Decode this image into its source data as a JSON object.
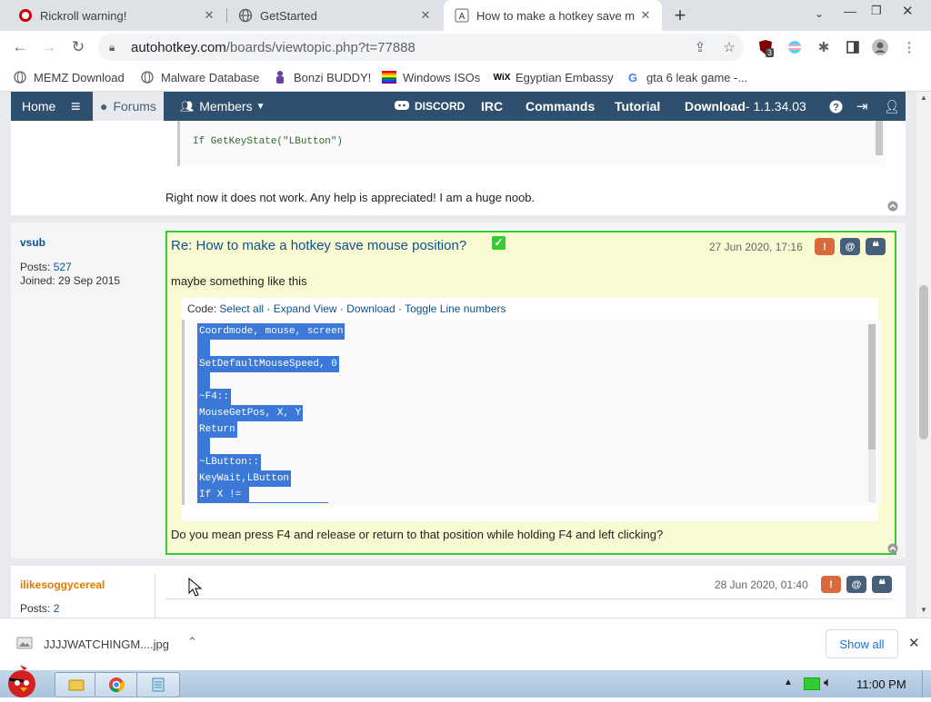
{
  "tabs": [
    {
      "title": "Rickroll warning!",
      "icon": "youtube-icon",
      "active": false
    },
    {
      "title": "GetStarted",
      "icon": "globe-icon",
      "active": false
    },
    {
      "title": "How to make a hotkey save m",
      "icon": "autohotkey-icon",
      "active": true
    }
  ],
  "new_tab_label": "+",
  "address": {
    "domain": "autohotkey.com",
    "path": "/boards/viewtopic.php?t=77888"
  },
  "extension_badge": "3",
  "bookmarks": [
    {
      "label": "MEMZ Download",
      "icon": "globe-icon"
    },
    {
      "label": "Malware Database",
      "icon": "globe-icon"
    },
    {
      "label": "Bonzi BUDDY!",
      "icon": "bonzi-icon"
    },
    {
      "label": "Windows ISOs",
      "icon": "rainbow-flag-icon"
    },
    {
      "label": "Egyptian Embassy",
      "icon": "wix-icon"
    },
    {
      "label": "gta 6 leak game -...",
      "icon": "google-icon"
    }
  ],
  "forum_nav": {
    "home": "Home",
    "forums": "Forums",
    "members": "Members",
    "discord": "DISCORD",
    "irc": "IRC",
    "commands": "Commands",
    "tutorial": "Tutorial",
    "download": "Download",
    "version": " - 1.1.34.03"
  },
  "prev_post": {
    "code_line": "If GetKeyState(\"LButton\")",
    "text": "Right now it does not work. Any help is appreciated! I am a huge noob."
  },
  "post": {
    "author": "vsub",
    "posts_label": "Posts:",
    "posts_count": "527",
    "joined_label": "Joined:",
    "joined": "29 Sep 2015",
    "title": "Re: How to make a hotkey save mouse position?",
    "date": "27 Jun 2020, 17:16",
    "intro": "maybe something like this",
    "code_label": "Code:",
    "code_links": [
      "Select all",
      "Expand View",
      "Download",
      "Toggle Line numbers"
    ],
    "code_lines": [
      "Coordmode, mouse, screen",
      "",
      "SetDefaultMouseSpeed, 0",
      "",
      "~F4::",
      "MouseGetPos, X, Y",
      "Return",
      "",
      "~LButton::",
      "KeyWait,LButton",
      "If X != "
    ],
    "reply": "Do you mean press F4 and release or return to that position while holding F4 and left clicking?"
  },
  "next_post": {
    "author": "ilikesoggycereal",
    "posts_label": "Posts:",
    "posts_count": "2",
    "date": "28 Jun 2020, 01:40"
  },
  "download": {
    "file": "JJJJWATCHINGM....jpg",
    "show_all": "Show all"
  },
  "clock": "11:00 PM",
  "colors": {
    "nav": "#2f4f6f",
    "post_highlight": "#fafad2",
    "highlight_border": "#33cc33",
    "selection": "#3c78d8",
    "report": "#d96a3b",
    "btn": "#46607a"
  }
}
